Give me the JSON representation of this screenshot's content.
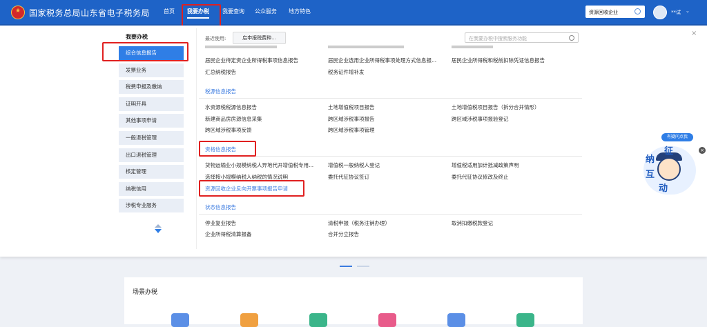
{
  "header": {
    "site_title": "国家税务总局山东省电子税务局",
    "nav": [
      {
        "label": "首页"
      },
      {
        "label": "我要办税",
        "active": true
      },
      {
        "label": "我要查询"
      },
      {
        "label": "公众服务"
      },
      {
        "label": "地方特色"
      }
    ],
    "company": "资源回收企业",
    "user_name": "**试",
    "logo_glyph": "★"
  },
  "sidebar": {
    "title": "我要办税",
    "items": [
      {
        "label": "综合信息报告",
        "active": true
      },
      {
        "label": "发票业务"
      },
      {
        "label": "税费申报及缴纳"
      },
      {
        "label": "证明开具"
      },
      {
        "label": "其他事项申请"
      },
      {
        "label": "一般退税管理"
      },
      {
        "label": "出口退税管理"
      },
      {
        "label": "核定管理"
      },
      {
        "label": "纳税信用"
      },
      {
        "label": "涉税专业服务"
      }
    ]
  },
  "recent": {
    "label": "最近使用:",
    "button": "启申报税费种..."
  },
  "func_search": {
    "placeholder": "在我要办税中搜索服务功能"
  },
  "close_icon": "×",
  "top_links": [
    "居民企业待定资企业所得税事项信息报告",
    "居民企业选用企业所得税事项处理方式信息报...",
    "居民企业所得税和税前扣除凭证信息报告",
    "汇总纳税报告",
    "税务证件增补发"
  ],
  "sections": [
    {
      "title": "税源信息报告",
      "links": [
        "水资源税税源信息报告",
        "土地增值税项目报告",
        "土地增值税项目报告（拆分合并情形）",
        "新建商品房房源信息采集",
        "跨区域涉税事项报告",
        "跨区域涉税事项报验登记",
        "跨区域涉税事项反馈",
        "跨区域涉税事项管理"
      ]
    },
    {
      "title": "资格信息报告",
      "links": [
        "货物运输业小规模纳税人异地代开增值税专用...",
        "增值税一般纳税人登记",
        "增值税适用加计抵减政策声明",
        "选择按小规模纳税人纳税的情况说明",
        "委托代征协议签订",
        "委托代征协议修改及终止",
        "资源回收企业反向开票事项报告申请"
      ]
    },
    {
      "title": "状态信息报告",
      "links": [
        "停业复业报告",
        "清税申报（税务注销办理）",
        "取消扣缴税款登记",
        "企业所得税清算报备",
        "合并分立报告"
      ]
    }
  ],
  "float": {
    "bubble": "有疑问点我",
    "chars": [
      "征",
      "纳",
      "互",
      "动"
    ],
    "small_btn": "×"
  },
  "lower": {
    "title": "场景办税"
  },
  "colors": {
    "brand": "#1e63c7",
    "active": "#2f7ee6",
    "highlight": "#e02020"
  }
}
